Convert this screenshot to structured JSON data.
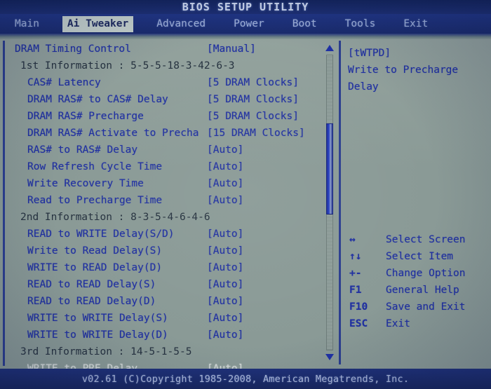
{
  "window": {
    "title": "BIOS SETUP UTILITY"
  },
  "tabs": [
    {
      "label": "Main",
      "active": false
    },
    {
      "label": "Ai Tweaker",
      "active": true
    },
    {
      "label": "Advanced",
      "active": false
    },
    {
      "label": "Power",
      "active": false
    },
    {
      "label": "Boot",
      "active": false
    },
    {
      "label": "Tools",
      "active": false
    },
    {
      "label": "Exit",
      "active": false
    }
  ],
  "settings": [
    {
      "label": "DRAM Timing Control",
      "value": "[Manual]",
      "level": 0,
      "kind": "setting"
    },
    {
      "label": "1st Information : 5-5-5-18-3-42-6-3",
      "value": "",
      "level": 1,
      "kind": "info"
    },
    {
      "label": "CAS# Latency",
      "value": "[5 DRAM Clocks]",
      "level": 2,
      "kind": "setting"
    },
    {
      "label": "DRAM RAS# to CAS# Delay",
      "value": "[5 DRAM Clocks]",
      "level": 2,
      "kind": "setting"
    },
    {
      "label": "DRAM RAS# Precharge",
      "value": "[5 DRAM Clocks]",
      "level": 2,
      "kind": "setting"
    },
    {
      "label": "DRAM RAS# Activate to Precha",
      "value": "[15 DRAM Clocks]",
      "level": 2,
      "kind": "setting"
    },
    {
      "label": "RAS# to RAS# Delay",
      "value": "[Auto]",
      "level": 2,
      "kind": "setting"
    },
    {
      "label": "Row Refresh Cycle Time",
      "value": "[Auto]",
      "level": 2,
      "kind": "setting"
    },
    {
      "label": "Write Recovery Time",
      "value": "[Auto]",
      "level": 2,
      "kind": "setting"
    },
    {
      "label": "Read to Precharge Time",
      "value": "[Auto]",
      "level": 2,
      "kind": "setting"
    },
    {
      "label": "2nd Information : 8-3-5-4-6-4-6",
      "value": "",
      "level": 1,
      "kind": "info"
    },
    {
      "label": "READ to WRITE Delay(S/D)",
      "value": "[Auto]",
      "level": 2,
      "kind": "setting"
    },
    {
      "label": "Write to Read Delay(S)",
      "value": "[Auto]",
      "level": 2,
      "kind": "setting"
    },
    {
      "label": "WRITE to READ Delay(D)",
      "value": "[Auto]",
      "level": 2,
      "kind": "setting"
    },
    {
      "label": "READ to READ Delay(S)",
      "value": "[Auto]",
      "level": 2,
      "kind": "setting"
    },
    {
      "label": "READ to READ Delay(D)",
      "value": "[Auto]",
      "level": 2,
      "kind": "setting"
    },
    {
      "label": "WRITE to WRITE Delay(S)",
      "value": "[Auto]",
      "level": 2,
      "kind": "setting"
    },
    {
      "label": "WRITE to WRITE Delay(D)",
      "value": "[Auto]",
      "level": 2,
      "kind": "setting"
    },
    {
      "label": "3rd Information : 14-5-1-5-5",
      "value": "",
      "level": 1,
      "kind": "info"
    },
    {
      "label": "WRITE to PRE Delay",
      "value": "[Auto]",
      "level": 2,
      "kind": "dim"
    }
  ],
  "help": {
    "lines": [
      "[tWTPD]",
      "Write to Precharge",
      "Delay"
    ]
  },
  "legend": [
    {
      "key": "↔",
      "desc": "Select Screen"
    },
    {
      "key": "↑↓",
      "desc": "Select Item"
    },
    {
      "key": "+-",
      "desc": "Change Option"
    },
    {
      "key": "F1",
      "desc": "General Help"
    },
    {
      "key": "F10",
      "desc": "Save and Exit"
    },
    {
      "key": "ESC",
      "desc": "Exit"
    }
  ],
  "scrollbar": {
    "up_arrow": "scroll-up-arrow",
    "down_arrow": "scroll-down-arrow"
  },
  "footer": {
    "copyright": "v02.61 (C)Copyright 1985-2008, American Megatrends, Inc."
  },
  "colors": {
    "panel_bg": "#8a9a96",
    "header_bg": "#1d2f73",
    "text_blue": "#1f2fa0",
    "text_slate": "#26323f",
    "active_tab_bg": "#c3cfcb",
    "border_blue": "#2b3e8f"
  }
}
